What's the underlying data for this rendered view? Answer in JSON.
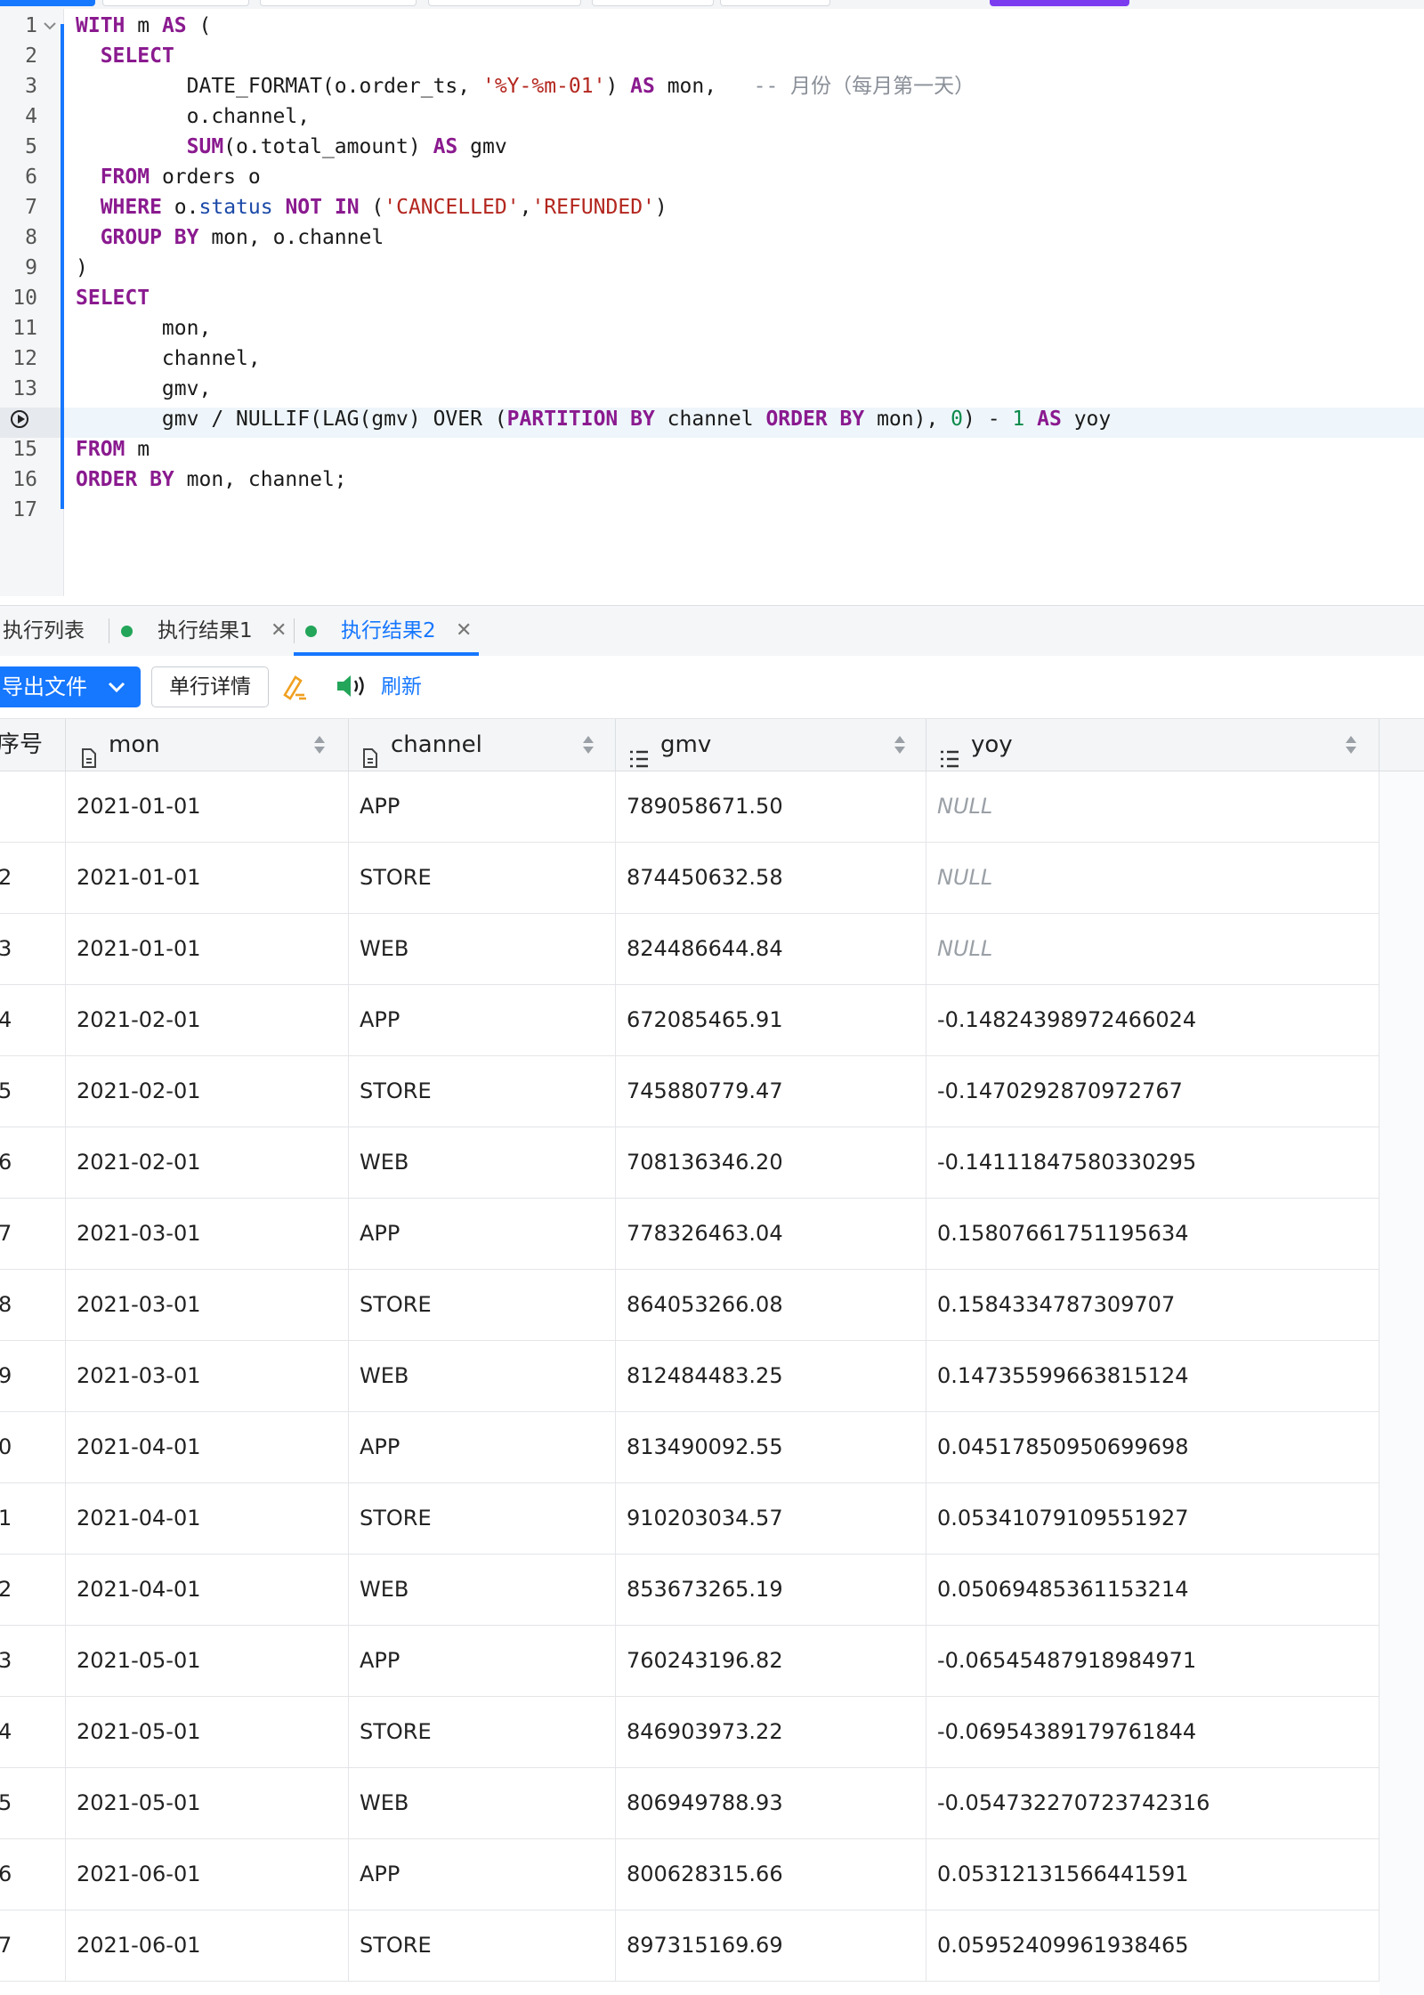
{
  "editor": {
    "lines": [
      {
        "n": "1",
        "html": "<span class=\"kw\">WITH</span> m <span class=\"kw\">AS</span> ("
      },
      {
        "n": "2",
        "html": "  <span class=\"kw\">SELECT</span>"
      },
      {
        "n": "3",
        "html": "         DATE_FORMAT(o.order_ts, <span class=\"str\">'%Y-%m-01'</span>) <span class=\"kw\">AS</span> mon,   <span class=\"cm\">-- 月份（每月第一天）</span>"
      },
      {
        "n": "4",
        "html": "         o.channel,"
      },
      {
        "n": "5",
        "html": "         <span class=\"kw\">SUM</span>(o.total_amount) <span class=\"kw\">AS</span> gmv"
      },
      {
        "n": "6",
        "html": "  <span class=\"kw\">FROM</span> orders o"
      },
      {
        "n": "7",
        "html": "  <span class=\"kw\">WHERE</span> o.<span class=\"prop\">status</span> <span class=\"kw\">NOT IN</span> (<span class=\"str\">'CANCELLED'</span>,<span class=\"str\">'REFUNDED'</span>)"
      },
      {
        "n": "8",
        "html": "  <span class=\"kw\">GROUP BY</span> mon, o.channel"
      },
      {
        "n": "9",
        "html": ")"
      },
      {
        "n": "10",
        "html": "<span class=\"kw\">SELECT</span>"
      },
      {
        "n": "11",
        "html": "       mon,"
      },
      {
        "n": "12",
        "html": "       channel,"
      },
      {
        "n": "13",
        "html": "       gmv,"
      },
      {
        "n": "",
        "html": "       gmv / NULLIF(LAG(gmv) OVER (<span class=\"kw\">PARTITION BY</span> channel <span class=\"kw\">ORDER BY</span> mon), <span class=\"num\">0</span>) - <span class=\"num\">1</span> <span class=\"kw\">AS</span> yoy"
      },
      {
        "n": "15",
        "html": "<span class=\"kw\">FROM</span> m"
      },
      {
        "n": "16",
        "html": "<span class=\"kw\">ORDER BY</span> mon, channel;"
      },
      {
        "n": "17",
        "html": ""
      }
    ]
  },
  "result_tabs": {
    "list": "执行列表",
    "result1": "执行结果1",
    "result2": "执行结果2"
  },
  "toolbar": {
    "export": "导出文件",
    "detail": "单行详情",
    "refresh": "刷新"
  },
  "table": {
    "columns": {
      "seq": "序号",
      "mon": "mon",
      "channel": "channel",
      "gmv": "gmv",
      "yoy": "yoy"
    },
    "rows": [
      {
        "seq": "",
        "mon": "2021-01-01",
        "channel": "APP",
        "gmv": "789058671.50",
        "yoy": "NULL"
      },
      {
        "seq": "2",
        "mon": "2021-01-01",
        "channel": "STORE",
        "gmv": "874450632.58",
        "yoy": "NULL"
      },
      {
        "seq": "3",
        "mon": "2021-01-01",
        "channel": "WEB",
        "gmv": "824486644.84",
        "yoy": "NULL"
      },
      {
        "seq": "4",
        "mon": "2021-02-01",
        "channel": "APP",
        "gmv": "672085465.91",
        "yoy": "-0.14824398972466024"
      },
      {
        "seq": "5",
        "mon": "2021-02-01",
        "channel": "STORE",
        "gmv": "745880779.47",
        "yoy": "-0.1470292870972767"
      },
      {
        "seq": "6",
        "mon": "2021-02-01",
        "channel": "WEB",
        "gmv": "708136346.20",
        "yoy": "-0.14111847580330295"
      },
      {
        "seq": "7",
        "mon": "2021-03-01",
        "channel": "APP",
        "gmv": "778326463.04",
        "yoy": "0.15807661751195634"
      },
      {
        "seq": "8",
        "mon": "2021-03-01",
        "channel": "STORE",
        "gmv": "864053266.08",
        "yoy": "0.1584334787309707"
      },
      {
        "seq": "9",
        "mon": "2021-03-01",
        "channel": "WEB",
        "gmv": "812484483.25",
        "yoy": "0.14735599663815124"
      },
      {
        "seq": "0",
        "mon": "2021-04-01",
        "channel": "APP",
        "gmv": "813490092.55",
        "yoy": "0.04517850950699698"
      },
      {
        "seq": "1",
        "mon": "2021-04-01",
        "channel": "STORE",
        "gmv": "910203034.57",
        "yoy": "0.05341079109551927"
      },
      {
        "seq": "2",
        "mon": "2021-04-01",
        "channel": "WEB",
        "gmv": "853673265.19",
        "yoy": "0.05069485361153214"
      },
      {
        "seq": "3",
        "mon": "2021-05-01",
        "channel": "APP",
        "gmv": "760243196.82",
        "yoy": "-0.06545487918984971"
      },
      {
        "seq": "4",
        "mon": "2021-05-01",
        "channel": "STORE",
        "gmv": "846903973.22",
        "yoy": "-0.06954389179761844"
      },
      {
        "seq": "5",
        "mon": "2021-05-01",
        "channel": "WEB",
        "gmv": "806949788.93",
        "yoy": "-0.054732270723742316"
      },
      {
        "seq": "6",
        "mon": "2021-06-01",
        "channel": "APP",
        "gmv": "800628315.66",
        "yoy": "0.05312131566441591"
      },
      {
        "seq": "7",
        "mon": "2021-06-01",
        "channel": "STORE",
        "gmv": "897315169.69",
        "yoy": "0.05952409961938465"
      }
    ]
  },
  "colors": {
    "accent": "#1677ff",
    "keyword": "#8a1a8f",
    "string": "#b3261e",
    "number": "#0b8a4a",
    "status_dot": "#23a55a"
  },
  "icons": {
    "export_chevron": "chevron-down-icon",
    "clear": "eraser-pencil-icon",
    "speaker": "speaker-icon",
    "run": "run-line-icon",
    "fold": "fold-chevron-icon",
    "text_column": "document-icon",
    "number_column": "list-icon",
    "sort": "sort-arrows-icon",
    "close": "close-icon"
  }
}
